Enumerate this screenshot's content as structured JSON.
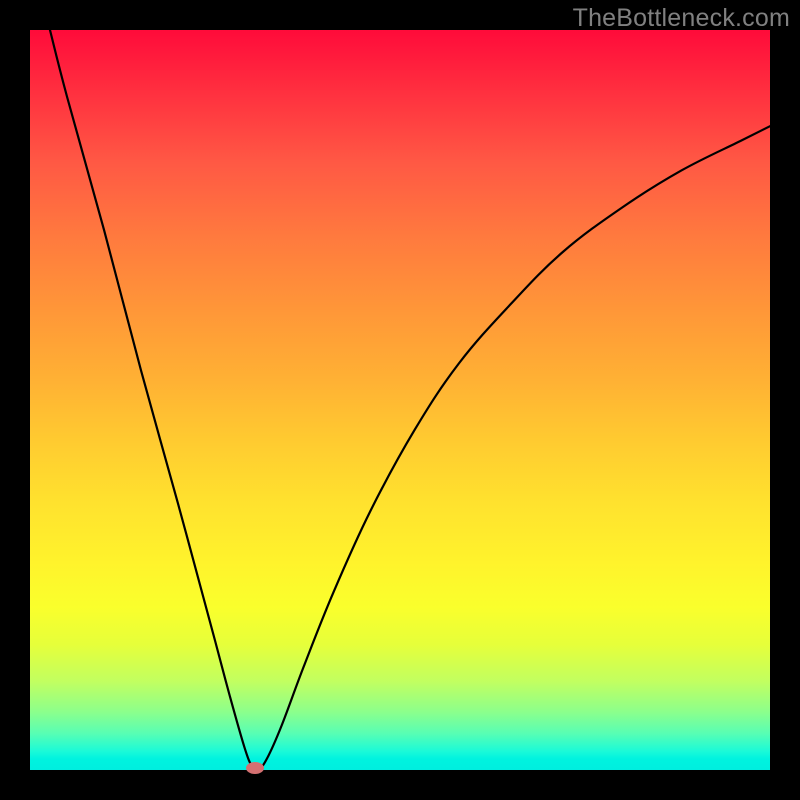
{
  "watermark": "TheBottleneck.com",
  "chart_data": {
    "type": "line",
    "title": "",
    "xlabel": "",
    "ylabel": "",
    "xlim": [
      0,
      100
    ],
    "ylim": [
      0,
      100
    ],
    "grid": false,
    "legend": false,
    "series": [
      {
        "name": "curve",
        "x": [
          2.7,
          5,
          10,
          15,
          20,
          25,
          27,
          29,
          30,
          30.8,
          32,
          34,
          37,
          41,
          46,
          52,
          58,
          65,
          72,
          80,
          88,
          96,
          100
        ],
        "y": [
          100,
          91,
          73,
          54,
          36,
          17.5,
          10,
          3,
          0.5,
          0,
          1.5,
          6,
          14,
          24,
          35,
          46,
          55,
          63,
          70,
          76,
          81,
          85,
          87
        ]
      }
    ],
    "annotations": [
      {
        "type": "marker",
        "x": 30.4,
        "y": 0.3,
        "color": "#d47071"
      }
    ],
    "background": "rainbow-gradient-vertical"
  }
}
